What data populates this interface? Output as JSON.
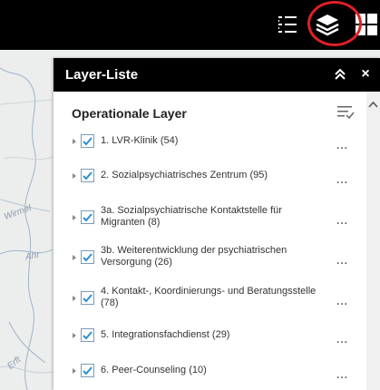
{
  "toolbar": {
    "items": [
      {
        "name": "legend-list-icon"
      },
      {
        "name": "layers-icon",
        "highlighted": true
      },
      {
        "name": "basemap-gallery-icon"
      }
    ],
    "highlight_color": "#e01f26"
  },
  "map": {
    "labels": [
      "Wirmel",
      "Ahr",
      "Erft"
    ]
  },
  "panel": {
    "title": "Layer-Liste",
    "subheader": "Operationale Layer",
    "collapse_symbol": "«",
    "close_symbol": "×",
    "menu_symbol": "...",
    "layers": [
      {
        "label": "1. LVR-Klinik (54)",
        "checked": true
      },
      {
        "label": "2. Sozialpsychiatrisches Zentrum (95)",
        "checked": true
      },
      {
        "label": "3a. Sozialpsychiatrische Kontaktstelle für Migranten (8)",
        "checked": true
      },
      {
        "label": "3b. Weiterentwicklung der psychiatrischen Versorgung (26)",
        "checked": true
      },
      {
        "label": "4. Kontakt-, Koordinierungs- und Beratungsstelle (78)",
        "checked": true
      },
      {
        "label": "5. Integrationsfachdienst (29)",
        "checked": true
      },
      {
        "label": "6. Peer-Counseling (10)",
        "checked": true
      }
    ]
  },
  "colors": {
    "header_bg": "#000000",
    "checkbox_check": "#2b8fd6",
    "panel_bg": "#ffffff"
  }
}
